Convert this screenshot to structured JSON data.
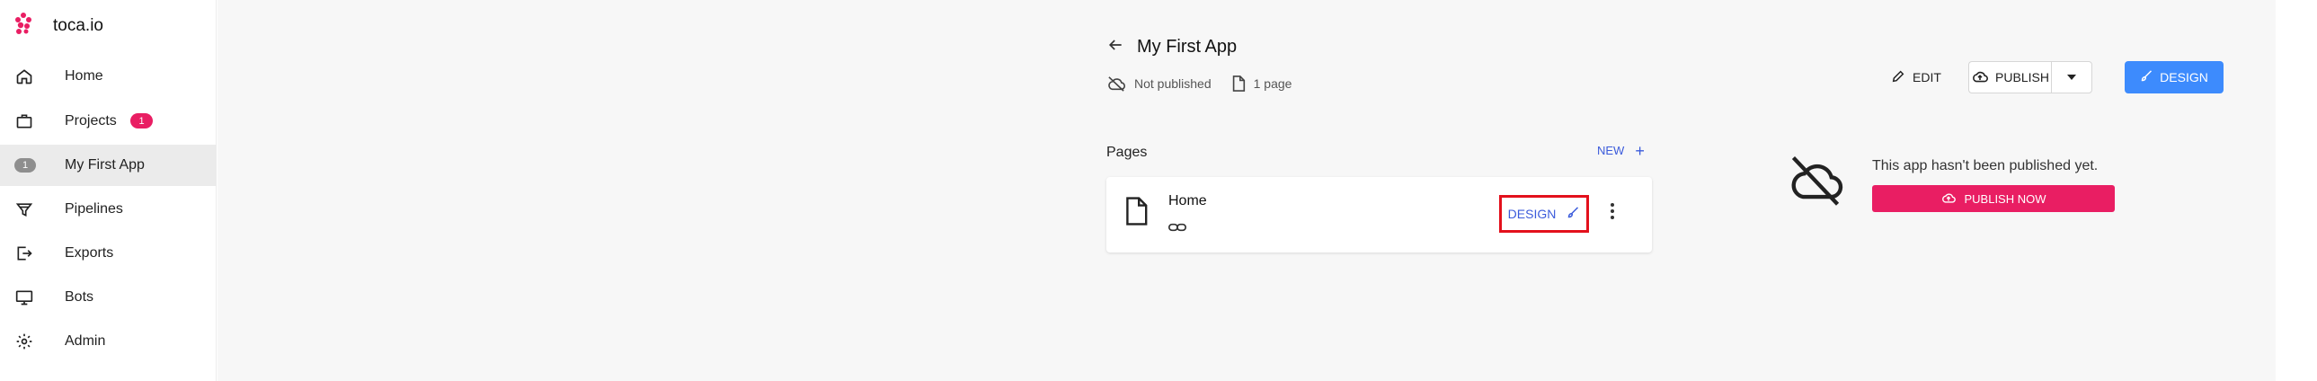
{
  "brand": {
    "name": "toca.io",
    "color": "#e91e63"
  },
  "sidebar": {
    "items": [
      {
        "label": "Home",
        "icon": "home-icon"
      },
      {
        "label": "Projects",
        "icon": "briefcase-icon",
        "badge": "1"
      },
      {
        "label": "My First App",
        "icon": "app-badge",
        "badge": "1",
        "active": true
      },
      {
        "label": "Pipelines",
        "icon": "filter-icon"
      },
      {
        "label": "Exports",
        "icon": "export-icon"
      },
      {
        "label": "Bots",
        "icon": "monitor-icon"
      },
      {
        "label": "Admin",
        "icon": "gear-icon"
      }
    ]
  },
  "app": {
    "title": "My First App",
    "status": "Not published",
    "page_count": "1 page"
  },
  "toolbar": {
    "edit_label": "EDIT",
    "publish_label": "PUBLISH",
    "design_label": "DESIGN",
    "design_color": "#3d8bfd"
  },
  "pages": {
    "heading": "Pages",
    "new_label": "NEW",
    "items": [
      {
        "name": "Home",
        "design_label": "DESIGN"
      }
    ]
  },
  "publish_panel": {
    "message": "This app hasn't been published yet.",
    "button_label": "PUBLISH NOW",
    "button_color": "#e91e63"
  }
}
